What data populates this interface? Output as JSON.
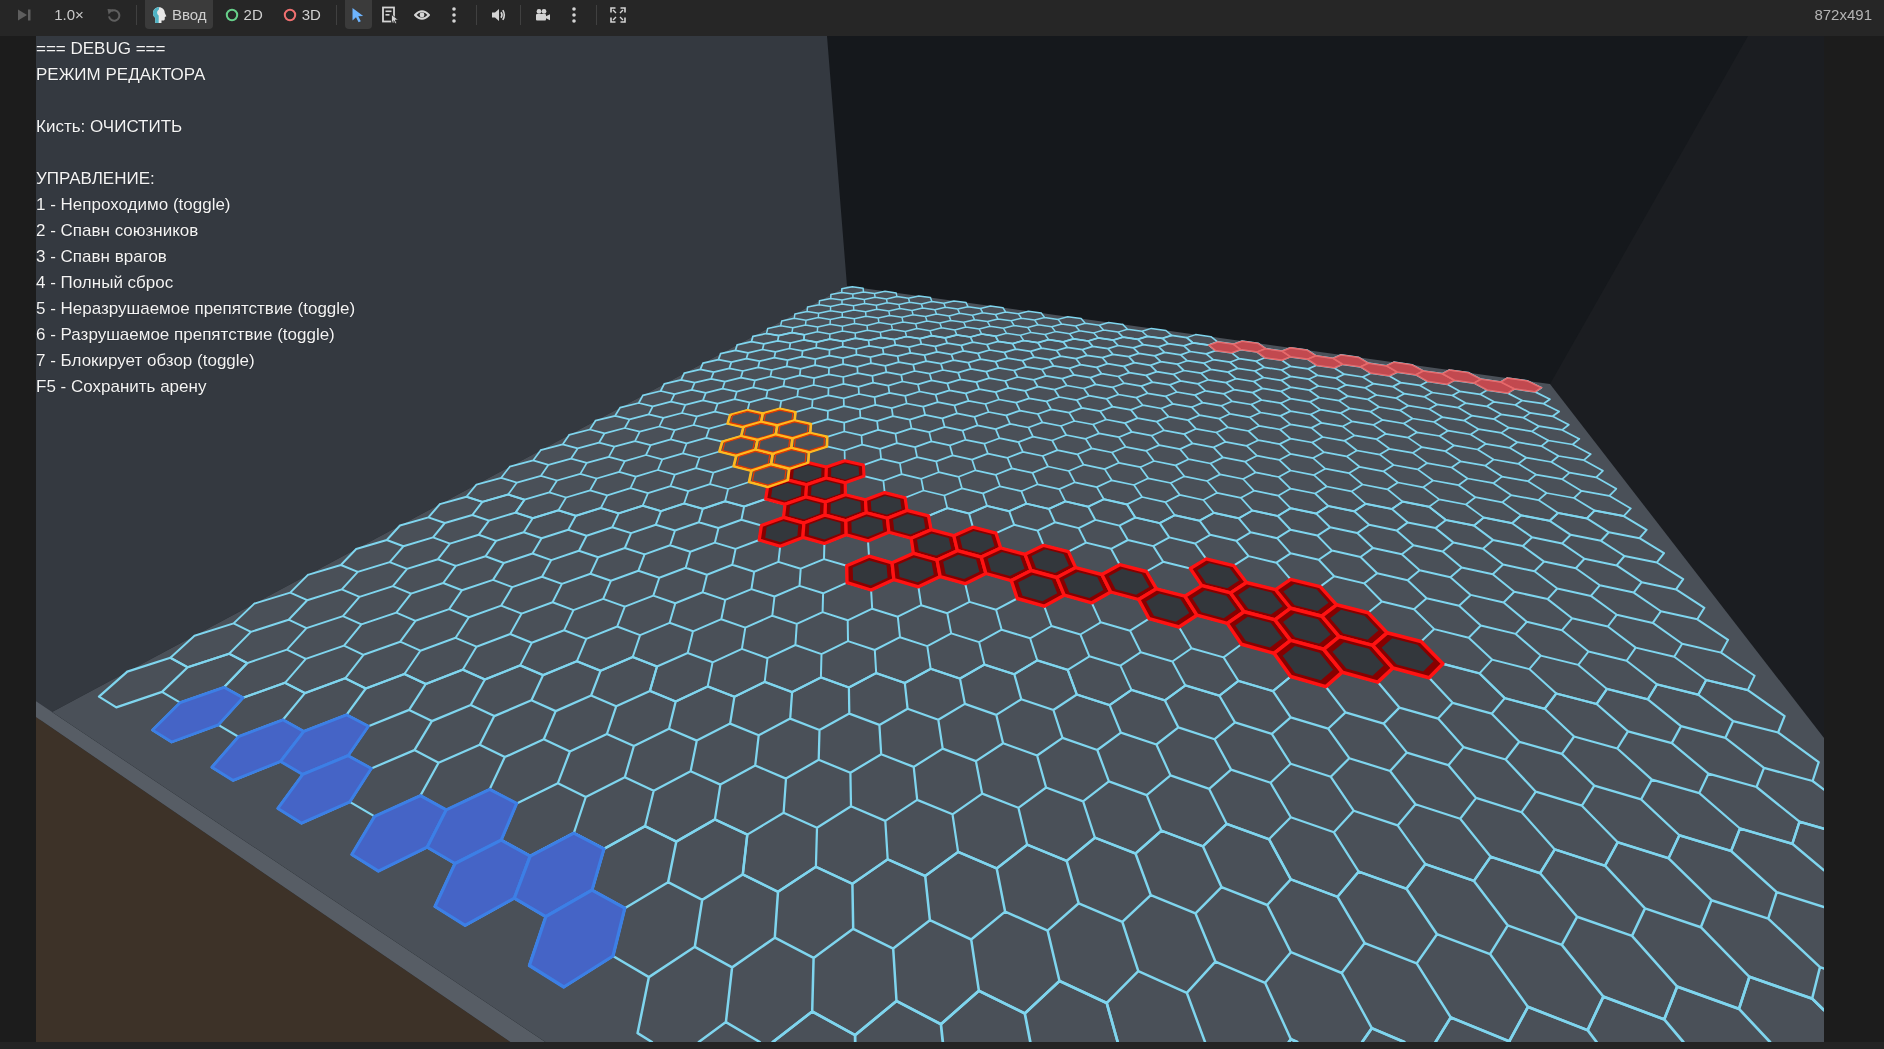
{
  "toolbar": {
    "playback": {
      "next_frame": {
        "disabled": true
      },
      "speed": {
        "label": "1.0×"
      },
      "reset_speed": {
        "disabled": true
      }
    },
    "modes": [
      {
        "label": "Ввод",
        "selected": true
      },
      {
        "label": "2D",
        "selected": false
      },
      {
        "label": "3D",
        "selected": false
      }
    ],
    "tools": [
      {
        "selected": true
      },
      {
        "selected": false
      }
    ],
    "viewport_size": "872x491"
  },
  "debug_overlay": {
    "title": "=== DEBUG ===",
    "mode": "РЕЖИМ РЕДАКТОРА",
    "brush": "Кисть: ОЧИСТИТЬ",
    "controls_heading": "УПРАВЛЕНИЕ:",
    "controls": [
      "1 - Непроходимо (toggle)",
      "2 - Спавн союзников",
      "3 - Спавн врагов",
      "4 - Полный сброс",
      "5 - Неразрушаемое препятствие (toggle)",
      "6 - Разрушаемое препятствие (toggle)",
      "7 - Блокирует обзор (toggle)",
      "F5 - Сохранить арену"
    ]
  }
}
